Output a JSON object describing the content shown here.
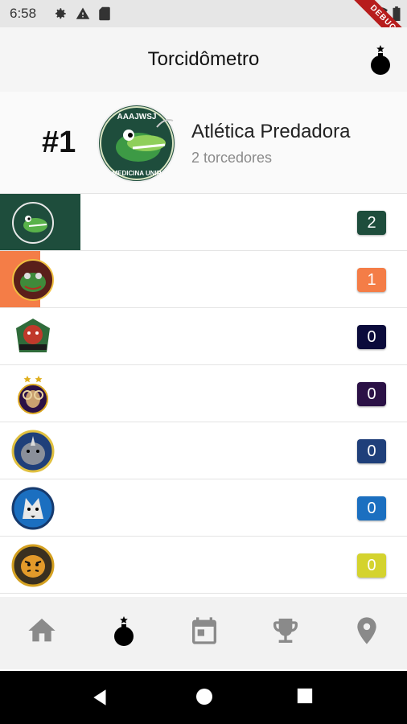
{
  "status_bar": {
    "time": "6:58",
    "debug_label": "DEBUG"
  },
  "app_bar": {
    "title": "Torcidômetro",
    "action_icon": "bomb-icon"
  },
  "leader": {
    "rank": "#1",
    "name": "Atlética Predadora",
    "supporters": "2 torcedores",
    "logo_text_top": "AAAJWSJ",
    "logo_text_bottom": "MEDICINA UNIR"
  },
  "teams": [
    {
      "score": "2",
      "color": "#1e4d3c",
      "bar_fraction": 1.0,
      "icon": "team-logo-gator"
    },
    {
      "score": "1",
      "color": "#f47d47",
      "bar_fraction": 0.5,
      "icon": "team-logo-frog"
    },
    {
      "score": "0",
      "color": "#0b0b3b",
      "bar_fraction": 0,
      "icon": "team-logo-red-beast"
    },
    {
      "score": "0",
      "color": "#2b1146",
      "bar_fraction": 0,
      "icon": "team-logo-ram"
    },
    {
      "score": "0",
      "color": "#1f3f7a",
      "bar_fraction": 0,
      "icon": "team-logo-rhino"
    },
    {
      "score": "0",
      "color": "#1b6fc0",
      "bar_fraction": 0,
      "icon": "team-logo-wolf"
    },
    {
      "score": "0",
      "color": "#d4d32e",
      "bar_fraction": 0,
      "icon": "team-logo-tiger"
    }
  ],
  "bottom_nav": {
    "items": [
      "home-icon",
      "bomb-icon",
      "calendar-icon",
      "trophy-icon",
      "location-icon"
    ],
    "selected": 1
  },
  "colors": {
    "accent": "#1e4d3c",
    "inactive_icon": "#8a8a8a"
  }
}
